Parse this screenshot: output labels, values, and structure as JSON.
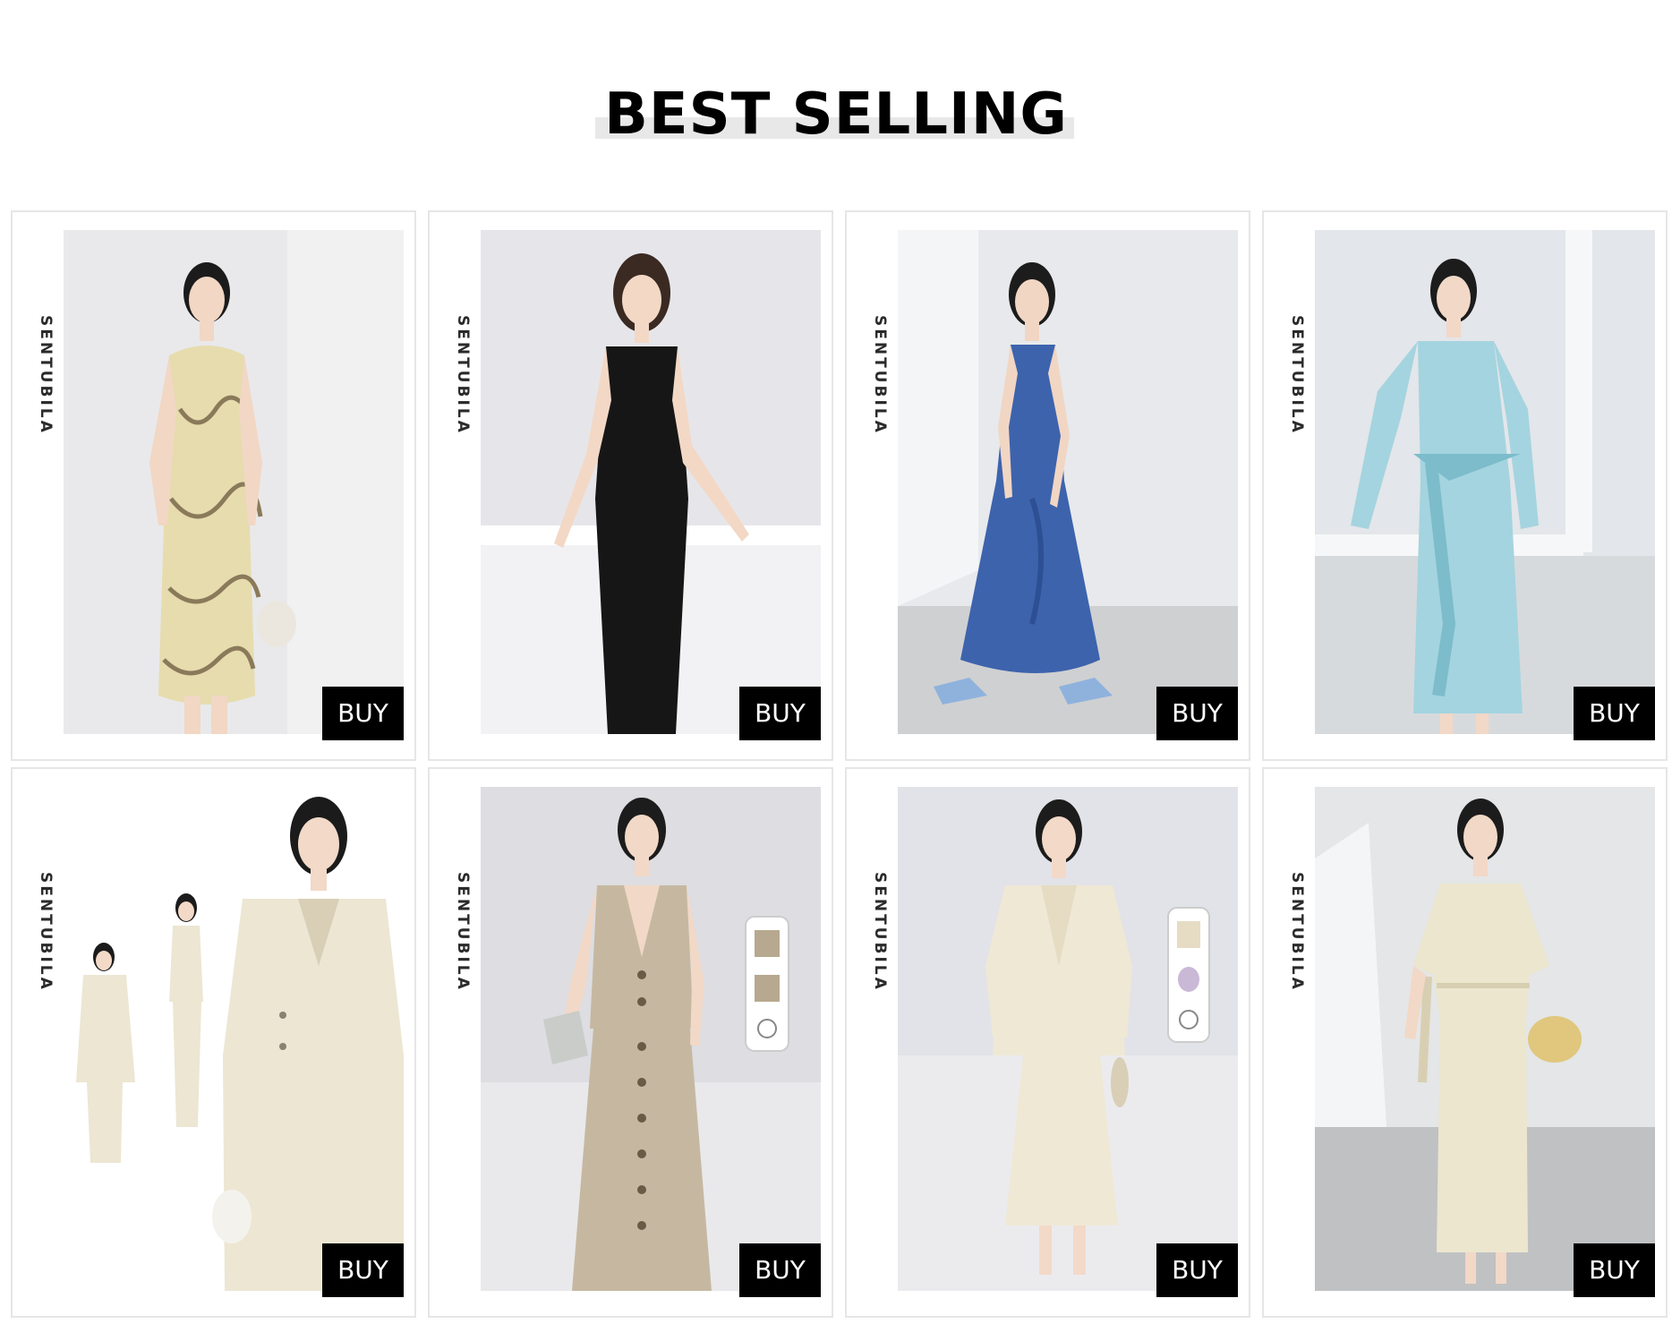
{
  "section": {
    "title": "BEST SELLING"
  },
  "products": [
    {
      "brand": "SENTUBILA",
      "buy_label": "BUY",
      "description": "Cream abstract-print slip dress",
      "colors": {
        "bg": "#e9e9eb",
        "floor": "#e2e2e4",
        "garment": "#e6dcae",
        "accent": "#8a7a5a",
        "skin": "#f1d7c4",
        "hair": "#1b1b1b"
      }
    },
    {
      "brand": "SENTUBILA",
      "buy_label": "BUY",
      "description": "Black sleeveless midi dress",
      "colors": {
        "bg": "#e6e6ea",
        "floor": "#f2f2f4",
        "garment": "#161616",
        "accent": "#2e2e2e",
        "skin": "#f3d8c6",
        "hair": "#3a2a22"
      }
    },
    {
      "brand": "SENTUBILA",
      "buy_label": "BUY",
      "description": "Blue satin slip dress",
      "colors": {
        "bg": "#e7e9ec",
        "floor": "#cfd0d2",
        "garment": "#3d63ad",
        "accent": "#8fb2dd",
        "skin": "#f1d6c4",
        "hair": "#1c1c1c"
      }
    },
    {
      "brand": "SENTUBILA",
      "buy_label": "BUY",
      "description": "Light blue wrap-tie dress",
      "colors": {
        "bg": "#e3e6ea",
        "floor": "#d7dadd",
        "garment": "#a4d4df",
        "accent": "#7cbccb",
        "skin": "#f2d8c7",
        "hair": "#1c1c1c"
      }
    },
    {
      "brand": "SENTUBILA",
      "buy_label": "BUY",
      "description": "Cream blazer and skirt set",
      "colors": {
        "bg": "#ffffff",
        "floor": "#ffffff",
        "garment": "#ece6d3",
        "accent": "#d8cfb6",
        "skin": "#f2d9c8",
        "hair": "#1b1b1b"
      }
    },
    {
      "brand": "SENTUBILA",
      "buy_label": "BUY",
      "description": "Khaki vest and button skirt set",
      "colors": {
        "bg": "#dddde2",
        "floor": "#e9e9ec",
        "garment": "#c6b8a0",
        "accent": "#6b5a45",
        "skin": "#f2d8c6",
        "hair": "#1c1c1c"
      }
    },
    {
      "brand": "SENTUBILA",
      "buy_label": "BUY",
      "description": "Cream blazer with midi skirt",
      "colors": {
        "bg": "#e2e3e8",
        "floor": "#ebebee",
        "garment": "#efe8d5",
        "accent": "#d9cfb6",
        "skin": "#f3d9c8",
        "hair": "#1c1c1c"
      }
    },
    {
      "brand": "SENTUBILA",
      "buy_label": "BUY",
      "description": "Cream short-sleeve belted dress",
      "colors": {
        "bg": "#e4e6e7",
        "floor": "#bfc1c3",
        "garment": "#ece6cf",
        "accent": "#e0c77d",
        "skin": "#f2d8c6",
        "hair": "#1c1c1c"
      }
    }
  ]
}
